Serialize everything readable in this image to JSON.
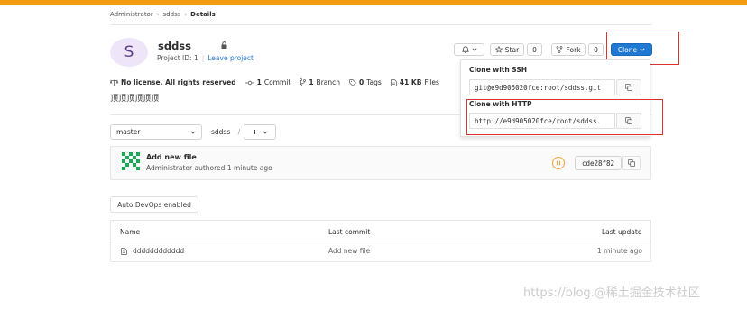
{
  "breadcrumb": [
    "Administrator",
    "sddss",
    "Details"
  ],
  "project": {
    "avatar_letter": "S",
    "name": "sddss",
    "id_text": "Project ID: 1",
    "leave_label": "Leave project"
  },
  "actions": {
    "notification_icon": "bell-icon",
    "star_label": "Star",
    "star_count": "0",
    "fork_label": "Fork",
    "fork_count": "0",
    "clone_label": "Clone"
  },
  "clone_dropdown": {
    "ssh_title": "Clone with SSH",
    "ssh_url": "git@e9d905020fce:root/sddss.git",
    "http_title": "Clone with HTTP",
    "http_url": "http://e9d905020fce/root/sddss."
  },
  "stats": {
    "license": "No license. All rights reserved",
    "commits_count": "1",
    "commits_label": "Commit",
    "branches_count": "1",
    "branches_label": "Branch",
    "tags_count": "0",
    "tags_label": "Tags",
    "files_size": "41 KB",
    "files_label": "Files"
  },
  "description": "顶顶顶顶顶顶",
  "repo_nav": {
    "branch": "master",
    "path": "sddss",
    "separator": "/",
    "add_label": "+"
  },
  "last_commit": {
    "message": "Add new file",
    "author_text": "Administrator authored 1 minute ago",
    "sha": "cde28f82"
  },
  "auto_devops": "Auto DevOps enabled",
  "file_table": {
    "headers": {
      "name": "Name",
      "last_commit": "Last commit",
      "last_update": "Last update"
    },
    "rows": [
      {
        "name": "dddddddddddd",
        "last_commit": "Add new file",
        "last_update": "1 minute ago"
      }
    ]
  },
  "watermark": "https://blog.@稀土掘金技术社区",
  "colors": {
    "accent": "#1f78d1",
    "topbar": "#f39c12",
    "highlight": "#e03131"
  }
}
